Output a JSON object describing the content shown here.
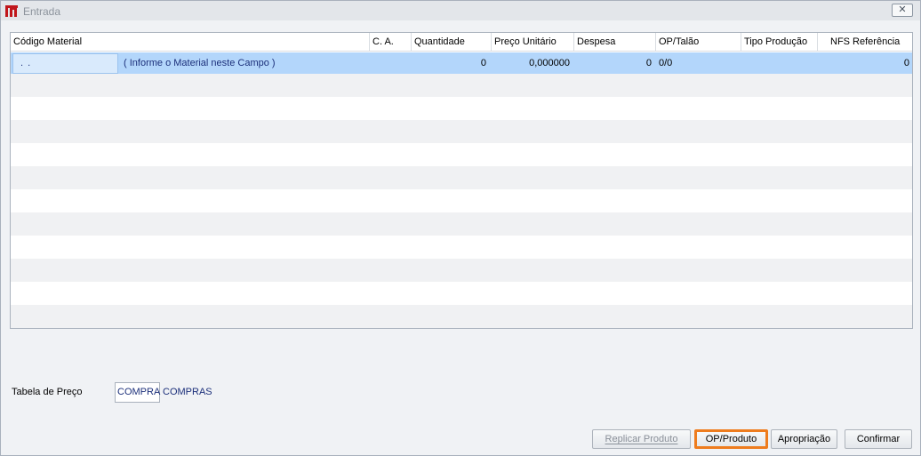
{
  "window": {
    "title": "Entrada",
    "close_label": "✕"
  },
  "grid": {
    "columns": [
      "Código Material",
      "C. A.",
      "Quantidade",
      "Preço Unitário",
      "Despesa",
      "OP/Talão",
      "Tipo Produção",
      "NFS Referência"
    ],
    "rows": [
      {
        "codigo": ". .",
        "descricao": "( Informe o Material neste Campo )",
        "ca": "",
        "quantidade": "0",
        "preco_unitario": "0,000000",
        "despesa": "0",
        "op_talao": "0/0",
        "tipo_producao": "",
        "nfs_referencia": "0"
      }
    ]
  },
  "tabela_preco": {
    "label": "Tabela de Preço",
    "value": "COMPRA",
    "description": "COMPRAS"
  },
  "buttons": {
    "replicar": "Replicar Produto",
    "op_produto": "OP/Produto",
    "apropriacao": "Apropriação",
    "confirmar": "Confirmar"
  },
  "colors": {
    "selected_row": "#b3d6fb",
    "focus_border": "#ee7c1e",
    "value_text": "#1b2f7a",
    "app_icon": "#c0161b"
  }
}
